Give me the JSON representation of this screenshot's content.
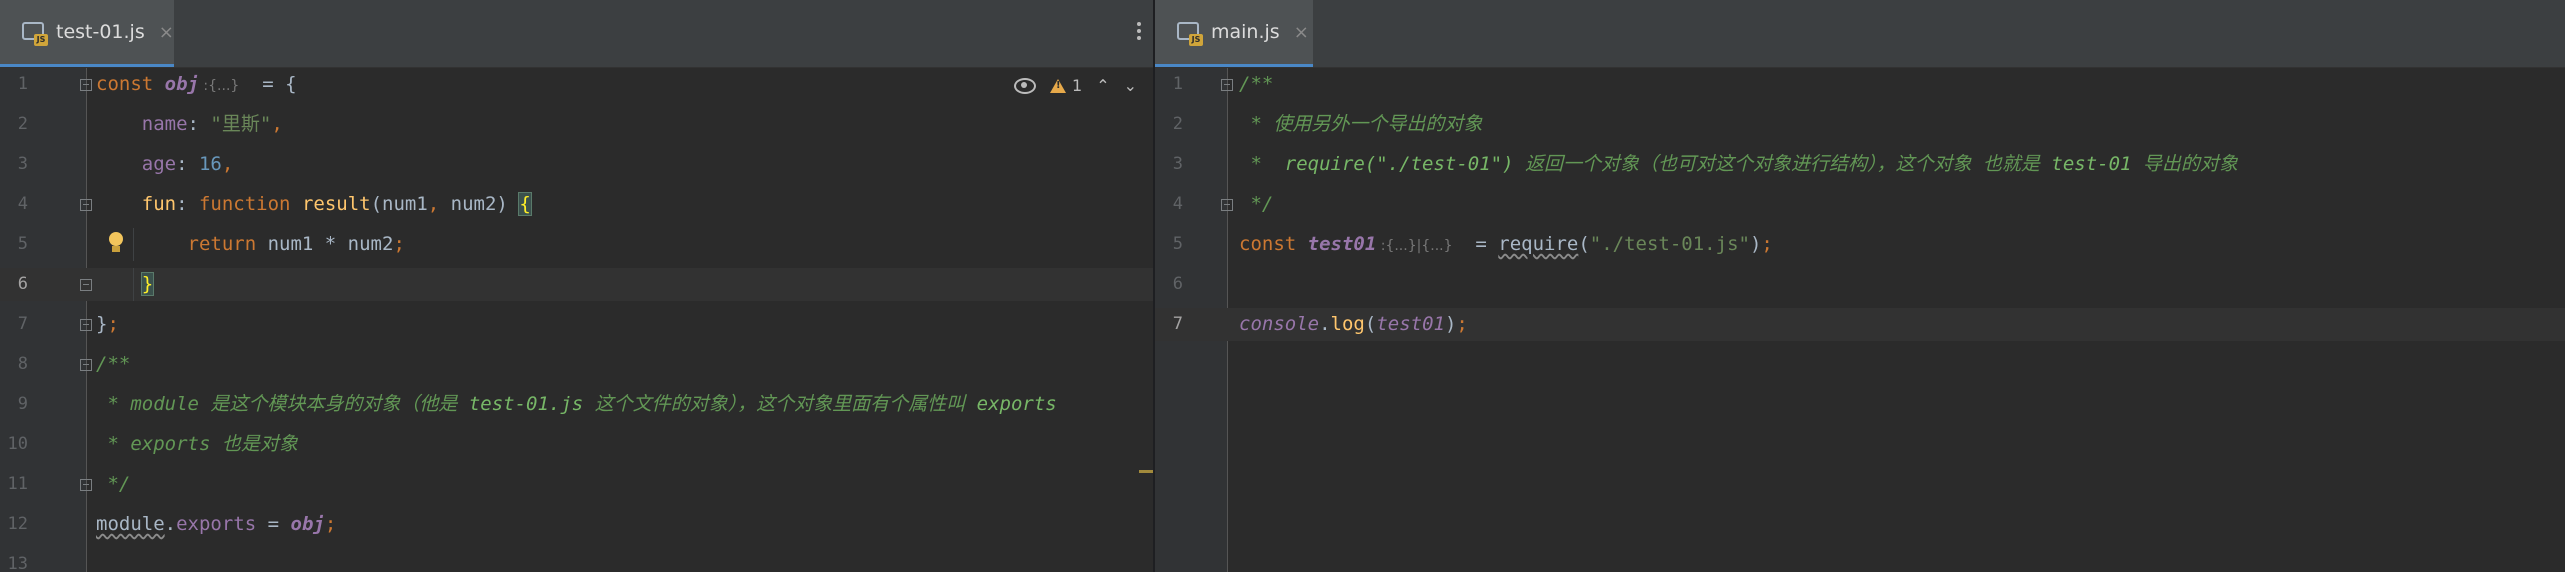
{
  "left": {
    "tab": {
      "title": "test-01.js",
      "close": "×",
      "icon": "js-file-icon"
    },
    "inspection": {
      "warnings": "1",
      "icons": [
        "eye-icon",
        "warning-icon",
        "chevron-up-icon",
        "chevron-down-icon"
      ]
    },
    "lines": [
      {
        "n": "1",
        "segments": [
          [
            "kw",
            "const "
          ],
          [
            "var",
            "obj"
          ],
          [
            "hint",
            " :{...}"
          ],
          [
            "plain",
            "  = {"
          ]
        ]
      },
      {
        "n": "2",
        "segments": [
          [
            "plain",
            "    "
          ],
          [
            "prop",
            "name"
          ],
          [
            "plain",
            ": "
          ],
          [
            "str",
            "\"里斯\""
          ],
          [
            "kw",
            ","
          ]
        ]
      },
      {
        "n": "3",
        "segments": [
          [
            "plain",
            "    "
          ],
          [
            "prop",
            "age"
          ],
          [
            "plain",
            ": "
          ],
          [
            "num",
            "16"
          ],
          [
            "kw",
            ","
          ]
        ]
      },
      {
        "n": "4",
        "segments": [
          [
            "plain",
            "    "
          ],
          [
            "fn",
            "fun"
          ],
          [
            "plain",
            ": "
          ],
          [
            "kw",
            "function "
          ],
          [
            "fn",
            "result"
          ],
          [
            "plain",
            "(num1"
          ],
          [
            "kw",
            ", "
          ],
          [
            "plain",
            "num2) "
          ],
          [
            "brace",
            "{"
          ]
        ]
      },
      {
        "n": "5",
        "segments": [
          [
            "plain",
            "        "
          ],
          [
            "kw",
            "return "
          ],
          [
            "plain",
            "num1 * num2"
          ],
          [
            "kw",
            ";"
          ]
        ]
      },
      {
        "n": "6",
        "segments": [
          [
            "plain",
            "    "
          ],
          [
            "brace",
            "}"
          ]
        ]
      },
      {
        "n": "7",
        "segments": [
          [
            "plain",
            "}"
          ],
          [
            "kw",
            ";"
          ]
        ]
      },
      {
        "n": "8",
        "segments": [
          [
            "cmt",
            "/**"
          ]
        ]
      },
      {
        "n": "9",
        "segments": [
          [
            "cmt",
            " * module 是这个模块本身的对象（他是 "
          ],
          [
            "cmt-code",
            "test-01.js"
          ],
          [
            "cmt",
            " 这个文件的对象），这个对象里面有个属性叫 "
          ],
          [
            "cmt-code",
            "exports"
          ]
        ]
      },
      {
        "n": "10",
        "segments": [
          [
            "cmt",
            " * exports 也是对象"
          ]
        ]
      },
      {
        "n": "11",
        "segments": [
          [
            "cmt",
            " */"
          ]
        ]
      },
      {
        "n": "12",
        "segments": [
          [
            "wavy",
            "module"
          ],
          [
            "plain",
            "."
          ],
          [
            "prop",
            "exports"
          ],
          [
            "plain",
            " = "
          ],
          [
            "var",
            "obj"
          ],
          [
            "kw",
            ";"
          ]
        ]
      },
      {
        "n": "13",
        "segments": []
      }
    ]
  },
  "right": {
    "tab": {
      "title": "main.js",
      "close": "×",
      "icon": "js-file-icon"
    },
    "lines": [
      {
        "n": "1",
        "segments": [
          [
            "cmt",
            "/**"
          ]
        ]
      },
      {
        "n": "2",
        "segments": [
          [
            "cmt",
            " * 使用另外一个导出的对象"
          ]
        ]
      },
      {
        "n": "3",
        "segments": [
          [
            "cmt",
            " *  "
          ],
          [
            "cmt-code",
            "require(\"./test-01\")"
          ],
          [
            "cmt",
            " 返回一个对象（也可对这个对象进行结构），这个对象 也就是 "
          ],
          [
            "cmt-code",
            "test-01"
          ],
          [
            "cmt",
            " 导出的对象"
          ]
        ]
      },
      {
        "n": "4",
        "segments": [
          [
            "cmt",
            " */"
          ]
        ]
      },
      {
        "n": "5",
        "segments": [
          [
            "kw",
            "const "
          ],
          [
            "var",
            "test01"
          ],
          [
            "hint",
            " :{...}|{...}"
          ],
          [
            "plain",
            "  = "
          ],
          [
            "wavy",
            "require"
          ],
          [
            "plain",
            "("
          ],
          [
            "str",
            "\"./test-01.js\""
          ],
          [
            "plain",
            ")"
          ],
          [
            "kw",
            ";"
          ]
        ]
      },
      {
        "n": "6",
        "segments": []
      },
      {
        "n": "7",
        "segments": [
          [
            "var-it",
            "console"
          ],
          [
            "plain",
            "."
          ],
          [
            "fn",
            "log"
          ],
          [
            "plain",
            "("
          ],
          [
            "var-it",
            "test01"
          ],
          [
            "plain",
            ")"
          ],
          [
            "kw",
            ";"
          ]
        ]
      }
    ]
  },
  "colors": {
    "background": "#2b2b2b",
    "keyword": "#cc7832",
    "string": "#6a8759",
    "number": "#6897bb",
    "function": "#ffc66d",
    "property": "#9876aa",
    "comment": "#629755",
    "tab_underline": "#4a88c7"
  }
}
